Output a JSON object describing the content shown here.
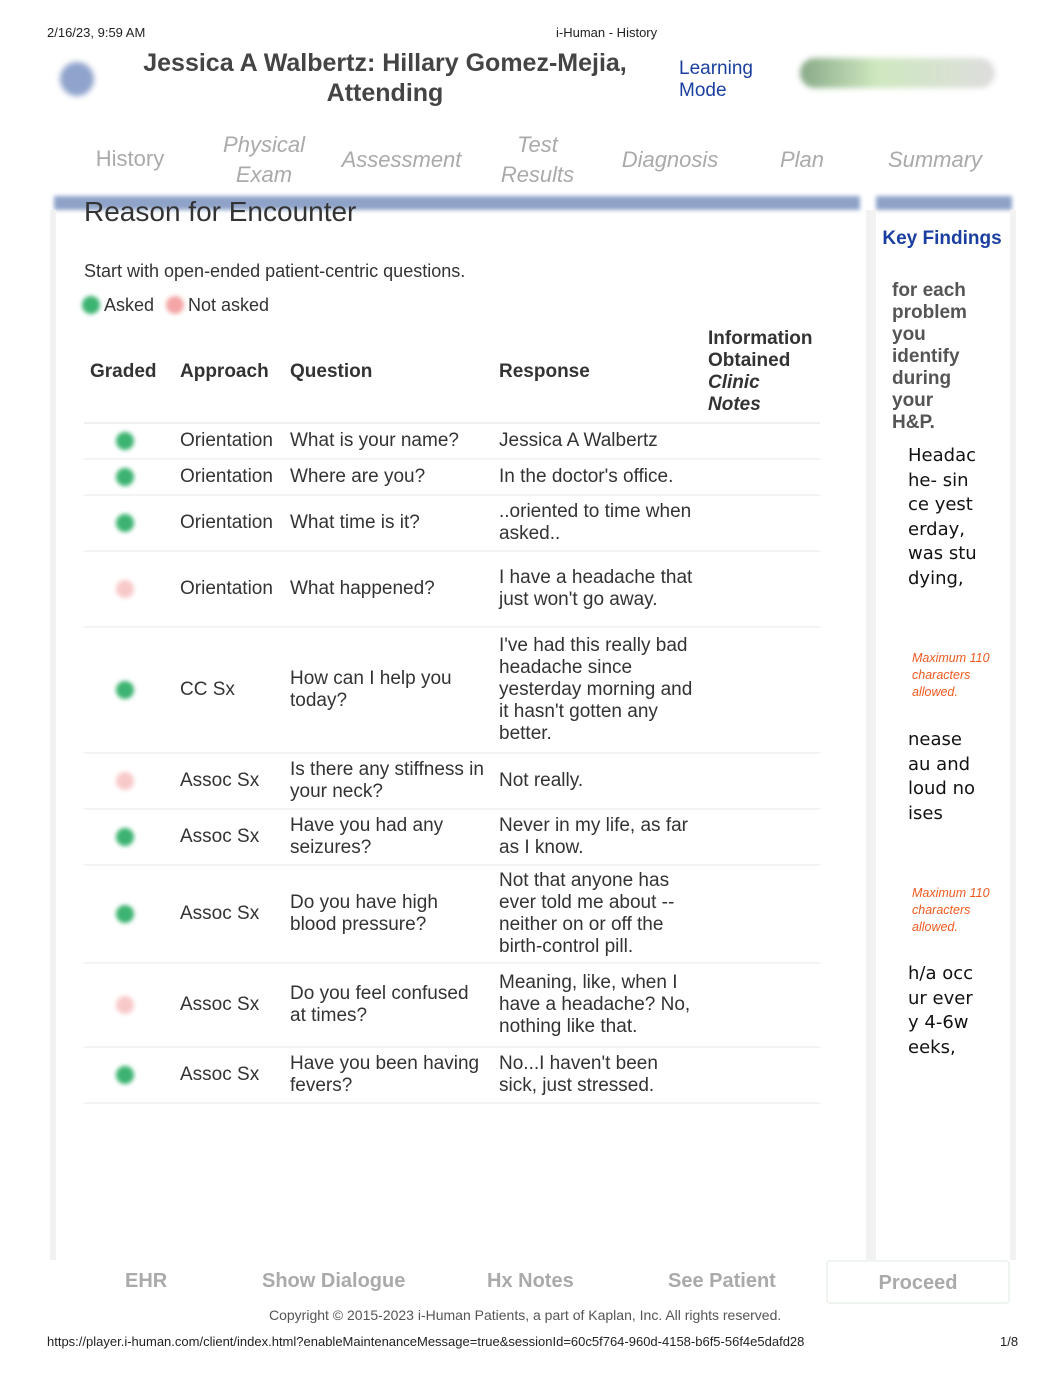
{
  "print_header": {
    "date": "2/16/23, 9:59 AM",
    "title": "i-Human - History"
  },
  "header": {
    "title": "Jessica A Walbertz: Hillary Gomez-Mejia, Attending",
    "mode": "Learning Mode"
  },
  "tabs": [
    {
      "label": "History"
    },
    {
      "label": "Physical Exam"
    },
    {
      "label": "Assessment"
    },
    {
      "label": "Test Results"
    },
    {
      "label": "Diagnosis"
    },
    {
      "label": "Plan"
    },
    {
      "label": "Summary"
    }
  ],
  "section": {
    "title": "Reason for Encounter",
    "instruction": "Start with open-ended patient-centric questions.",
    "legend_asked": "Asked",
    "legend_not_asked": "Not asked"
  },
  "colors": {
    "asked": "#3cb371",
    "not_asked": "#f4a6a6",
    "accent": "#1a3fa0",
    "warning": "#f05a20"
  },
  "table": {
    "headers": {
      "graded": "Graded",
      "approach": "Approach",
      "question": "Question",
      "response": "Response",
      "info": "Information Obtained",
      "info_italic": "Clinic Notes"
    },
    "rows": [
      {
        "asked": true,
        "approach": "Orientation",
        "question": "What is your name?",
        "response": "Jessica A Walbertz"
      },
      {
        "asked": true,
        "approach": "Orientation",
        "question": "Where are you?",
        "response": "In the doctor's office."
      },
      {
        "asked": true,
        "approach": "Orientation",
        "question": "What time is it?",
        "response": "..oriented to time when asked.."
      },
      {
        "asked": false,
        "approach": "Orientation",
        "question": "What happened?",
        "response": "I have a headache that just won't go away."
      },
      {
        "asked": true,
        "approach": "CC Sx",
        "question": "How can I help you today?",
        "response": "I've had this really bad headache since yesterday morning and it hasn't gotten any better."
      },
      {
        "asked": false,
        "approach": "Assoc Sx",
        "question": "Is there any stiffness in your neck?",
        "response": "Not really."
      },
      {
        "asked": true,
        "approach": "Assoc Sx",
        "question": "Have you had any seizures?",
        "response": "Never in my life, as far as I know."
      },
      {
        "asked": true,
        "approach": "Assoc Sx",
        "question": "Do you have high blood pressure?",
        "response": "Not that anyone has ever told me about -- neither on or off the birth-control pill."
      },
      {
        "asked": false,
        "approach": "Assoc Sx",
        "question": "Do you feel confused at times?",
        "response": "Meaning, like, when I have a headache? No, nothing like that."
      },
      {
        "asked": true,
        "approach": "Assoc Sx",
        "question": "Have you been having fevers?",
        "response": "No...I haven't been sick, just stressed."
      }
    ]
  },
  "key_findings": {
    "title": "Key Findings",
    "instruction": "for each problem you identify during your H&P.",
    "notes": [
      {
        "text": "Headache- since yesterday, was studying,",
        "warning": "Maximum 110 characters allowed."
      },
      {
        "text": "nease au and loud noises",
        "warning": "Maximum 110 characters allowed."
      },
      {
        "text": "h/a occur every 4-6weeks,"
      }
    ]
  },
  "footer": {
    "ehr": "EHR",
    "dialogue": "Show Dialogue",
    "hx": "Hx Notes",
    "see": "See Patient",
    "proceed": "Proceed",
    "copyright": "Copyright © 2015-2023 i-Human Patients, a part of Kaplan, Inc. All rights reserved."
  },
  "print_footer": {
    "url": "https://player.i-human.com/client/index.html?enableMaintenanceMessage=true&sessionId=60c5f764-960d-4158-b6f5-56f4e5dafd28",
    "page": "1/8"
  }
}
